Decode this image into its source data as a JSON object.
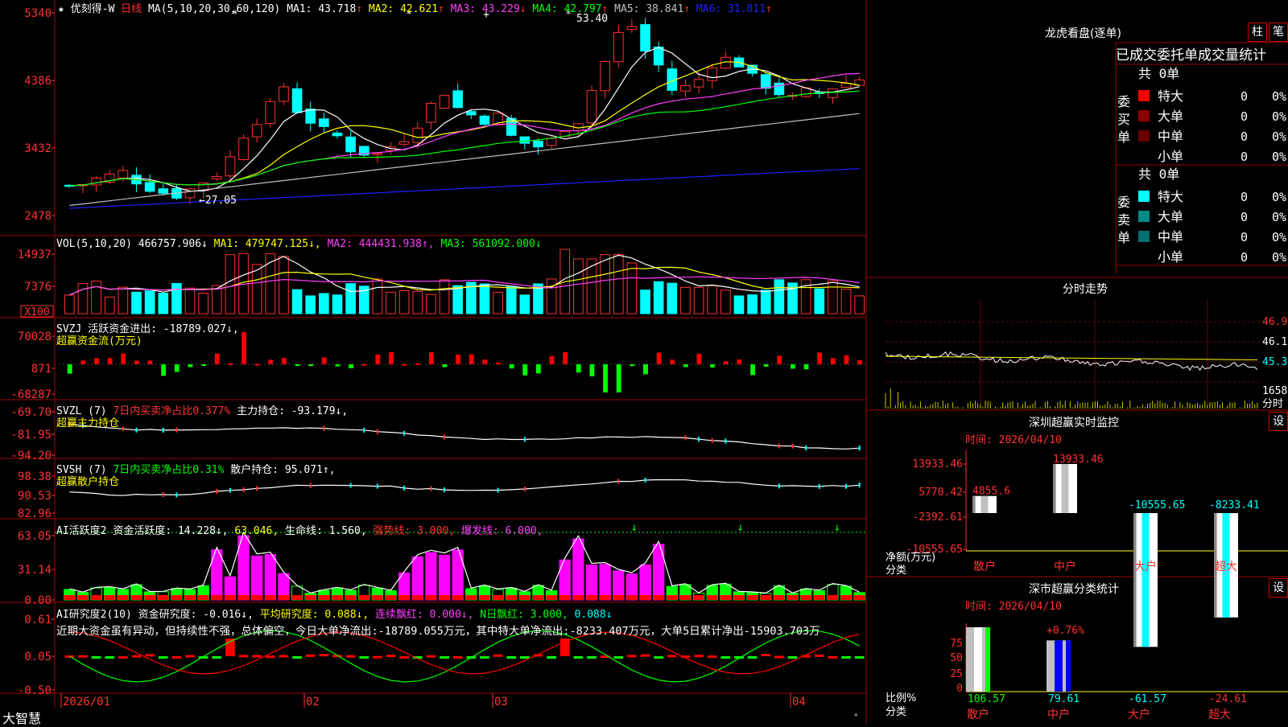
{
  "main": {
    "legend": {
      "star": "★",
      "name": "优刻得-W",
      "period": "日线",
      "ma_spec": "MA(5,10,20,30,60,120)",
      "mas": [
        {
          "label": "MA1: 43.718↑",
          "color": "#ffffff"
        },
        {
          "label": "MA2: 42.621↑",
          "color": "#ffff00"
        },
        {
          "label": "MA3: 43.229↓",
          "color": "#ff40ff"
        },
        {
          "label": "MA4: 42.797↑",
          "color": "#00ff00"
        },
        {
          "label": "MA5: 38.841↑",
          "color": "#c0c0c0"
        },
        {
          "label": "MA6: 31.811↑",
          "color": "#2020ff"
        }
      ]
    },
    "y_labels": [
      "5340",
      "4386",
      "3432",
      "2478"
    ],
    "high_label": "53.40",
    "low_label": "27.05",
    "star_marks": [
      "*",
      "*",
      "+",
      "*"
    ]
  },
  "vol": {
    "header": "VOL(5,10,20)",
    "value": "466757.906↓",
    "ma1": "MA1: 479747.125↓,",
    "ma2": "MA2: 444431.938↑,",
    "ma3": "MA3: 561092.000↓",
    "y_labels": [
      "14937",
      "7376"
    ],
    "unit": "X100"
  },
  "svzj": {
    "name": "SVZJ",
    "text": "活跃资金进出: -18789.027↓,",
    "subtitle": "超赢资金流(万元)",
    "y_labels": [
      "70028",
      "871",
      "-68287"
    ]
  },
  "svzl": {
    "name": "SVZL (7)",
    "ratio": "7日内买卖净占比0.377%",
    "text": "主力持仓: -93.179↓,",
    "subtitle": "超赢主力持仓",
    "y_labels": [
      "-69.70",
      "-81.95",
      "-94.20"
    ]
  },
  "svsh": {
    "name": "SVSH (7)",
    "ratio": "7日内买卖净占比0.31%",
    "text": "散户持仓: 95.071↑,",
    "subtitle": "超赢散户持仓",
    "y_labels": [
      "98.38",
      "90.53",
      "82.96"
    ]
  },
  "ai_active": {
    "name": "AI活跃度2",
    "text": "资金活跃度: 14.228↓,",
    "v2": "63.046,",
    "v3": "生命线: 1.560,",
    "strong": "强势线: 3.000,",
    "burst": "爆发线: 6.000,",
    "y_labels": [
      "63.05",
      "31.14",
      "0.00"
    ]
  },
  "ai_research": {
    "name": "AI研究度2(10)",
    "text": "资金研究度: -0.016↓,",
    "avg": "平均研究度: 0.088↓,",
    "streak": "连续飘红: 0.000↓,",
    "nday": "N日飘红: 3.000,",
    "last": "0.088↓",
    "comment": "近期大资金虽有异动，但持续性不强，总体偏空，今日大单净流出:-18789.055万元，其中特大单净流出:-8233.407万元，大单5日累计净出-15903.703万",
    "y_labels": [
      "0.61",
      "0.05",
      "-0.50"
    ]
  },
  "footer": {
    "brand": "大智慧",
    "dates": [
      "2026/01",
      "02",
      "03",
      "04"
    ]
  },
  "right": {
    "dragon_title": "龙虎看盘(逐单)",
    "btn_zhu": "柱",
    "btn_bi": "笔",
    "stats_title": "已成交委托单成交量统计",
    "buy": {
      "side_label": "委买单",
      "total": "共 0单",
      "rows": [
        {
          "name": "特大",
          "count": "0",
          "pct": "0%",
          "color": "#ff0000"
        },
        {
          "name": "大单",
          "count": "0",
          "pct": "0%",
          "color": "#8b0000"
        },
        {
          "name": "中单",
          "count": "0",
          "pct": "0%",
          "color": "#6a0000"
        },
        {
          "name": "小单",
          "count": "0",
          "pct": "0%",
          "color": "#000000"
        }
      ]
    },
    "sell": {
      "side_label": "委卖单",
      "total": "共 0单",
      "rows": [
        {
          "name": "特大",
          "count": "0",
          "pct": "0%",
          "color": "#00ffff"
        },
        {
          "name": "大单",
          "count": "0",
          "pct": "0%",
          "color": "#008b8b"
        },
        {
          "name": "中单",
          "count": "0",
          "pct": "0%",
          "color": "#007070"
        },
        {
          "name": "小单",
          "count": "0",
          "pct": "0%",
          "color": "#000000"
        }
      ]
    },
    "fenshi": {
      "title": "分时走势",
      "y_labels": [
        "46.9",
        "46.1",
        "45.3"
      ],
      "vol_label": "1658",
      "unit_label": "分时"
    },
    "monitor": {
      "title": "深圳超赢实时监控",
      "btn": "设",
      "time": "时间: 2026/04/10",
      "y_labels": [
        "13933.46",
        "5770.42",
        "-2392.61",
        "-10555.65"
      ],
      "bars": [
        {
          "cat": "散户",
          "value": 4855.6,
          "label": "4855.6",
          "lcolor": "#ff3232"
        },
        {
          "cat": "中户",
          "value": 13933.46,
          "label": "13933.46",
          "lcolor": "#ff3232"
        },
        {
          "cat": "大户",
          "value": -10555.65,
          "label": "-10555.65",
          "lcolor": "#00ffff"
        },
        {
          "cat": "超大",
          "value": -8233.41,
          "label": "-8233.41",
          "lcolor": "#00ffff"
        }
      ],
      "y_unit": "净额(万元)",
      "x_unit": "分类"
    },
    "classify": {
      "title": "深市超赢分类统计",
      "btn": "设",
      "time": "时间: 2026/04/10",
      "y_labels": [
        "75",
        "50",
        "25",
        "0"
      ],
      "top_label": "+0.76%",
      "bars": [
        {
          "cat": "散户",
          "value": 100,
          "label": "106.57",
          "lcolor": "#00ff00"
        },
        {
          "cat": "中户",
          "value": 79.61,
          "label": "79.61",
          "lcolor": "#00ffff"
        },
        {
          "cat": "大户",
          "value": 0,
          "label": "-61.57",
          "lcolor": "#00ffff"
        },
        {
          "cat": "超大",
          "value": 0,
          "label": "-24.61",
          "lcolor": "#ff3232"
        }
      ],
      "y_unit": "比例%",
      "x_unit": "分类"
    }
  }
}
